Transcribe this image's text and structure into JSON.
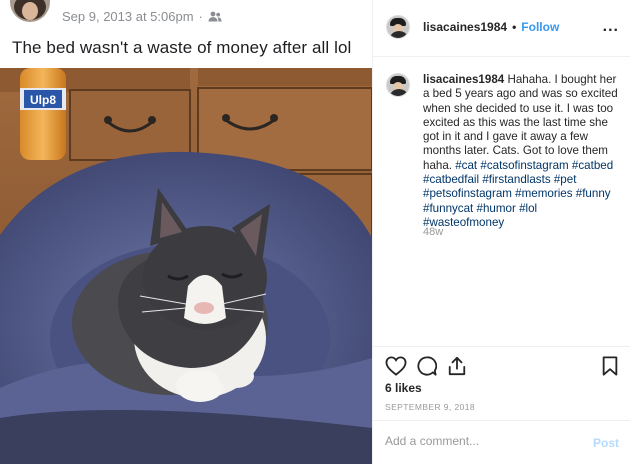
{
  "facebook_post": {
    "timestamp": "Sep 9, 2013 at 5:06pm",
    "separator": "·",
    "audience_icon": "friends-icon",
    "caption": "The bed wasn't a waste of money after all lol"
  },
  "photo": {
    "bottle_label": "Ulp8"
  },
  "instagram": {
    "username": "lisacaines1984",
    "separator": "•",
    "follow_label": "Follow",
    "more_label": "...",
    "caption_text": " Hahaha. I bought her a bed 5 years ago and was so excited when she decided to use it. I was too excited as this was the last time she got in it and I gave it away a few months later. Cats. Got to love them haha. ",
    "hashtags": [
      "#cat",
      "#catsofinstagram",
      "#catbed",
      "#catbedfail",
      "#firstandlasts",
      "#pet",
      "#petsofinstagram",
      "#memories",
      "#funny",
      "#funnycat",
      "#humor",
      "#lol",
      "#wasteofmoney"
    ],
    "time_ago": "48w",
    "likes": "6 likes",
    "date": "SEPTEMBER 9, 2018",
    "comment_placeholder": "Add a comment...",
    "post_label": "Post",
    "icons": [
      "heart-icon",
      "comment-icon",
      "share-icon",
      "bookmark-icon"
    ]
  }
}
